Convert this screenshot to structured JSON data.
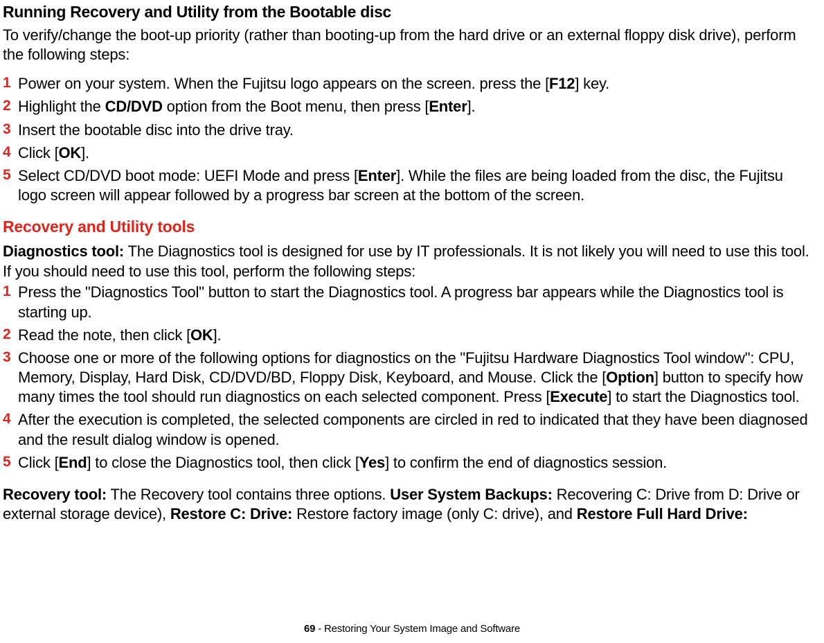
{
  "page": {
    "number": "69",
    "footer_sep": " - ",
    "footer_title": "Restoring Your System Image and Software"
  },
  "section1": {
    "heading": "Running Recovery and Utility from the Bootable disc",
    "lead": "To verify/change the boot-up priority (rather than booting-up from the hard drive or an external floppy disk drive), perform the following steps:",
    "steps": {
      "s1": {
        "n": "1",
        "pre": "Power on your system. When the Fujitsu logo appears on the screen. press the [",
        "b1": "F12",
        "post": "] key."
      },
      "s2": {
        "n": "2",
        "pre": "Highlight the ",
        "b1": "CD/DVD",
        "mid": " option from the Boot menu, then press [",
        "b2": "Enter",
        "post": "]."
      },
      "s3": {
        "n": "3",
        "text": "Insert the bootable disc into the drive tray."
      },
      "s4": {
        "n": "4",
        "pre": "Click [",
        "b1": "OK",
        "post": "]."
      },
      "s5": {
        "n": "5",
        "pre": "Select CD/DVD boot mode: UEFI Mode and press [",
        "b1": "Enter",
        "post": "]. While the files are being loaded from the disc, the Fujitsu logo screen will appear followed by a progress bar screen at the bottom of the screen."
      }
    }
  },
  "section2": {
    "heading": "Recovery and Utility tools",
    "diag": {
      "title": "Diagnostics tool:",
      "lead": " The Diagnostics tool is designed for use by IT professionals. It is not likely you will need to use this tool. If you should need to use this tool, perform the following steps:",
      "steps": {
        "s1": {
          "n": "1",
          "text": "Press the \"Diagnostics Tool\" button to start the Diagnostics tool. A progress bar appears while the Diagnostics tool is starting up."
        },
        "s2": {
          "n": "2",
          "pre": "Read the note, then click [",
          "b1": "OK",
          "post": "]."
        },
        "s3": {
          "n": "3",
          "pre": "Choose one or more of the following options for diagnostics on the \"Fujitsu Hardware Diagnostics Tool window\": CPU, Memory, Display, Hard Disk, CD/DVD/BD, Floppy Disk, Keyboard, and Mouse. Click the [",
          "b1": "Option",
          "mid": "] button to specify how many times the tool should run diagnostics on each selected component. Press [",
          "b2": "Execute",
          "post": "] to start the Diagnostics tool."
        },
        "s4": {
          "n": "4",
          "text": "After the execution is completed, the selected components are circled in red to indicated that they have been diagnosed and the result dialog window is opened."
        },
        "s5": {
          "n": "5",
          "pre": "Click [",
          "b1": "End",
          "mid": "] to close the Diagnostics tool, then click [",
          "b2": "Yes",
          "post": "] to confirm the end of diagnostics session."
        }
      }
    },
    "recov": {
      "title": "Recovery tool:",
      "p1": " The Recovery tool contains three options. ",
      "b1": "User System Backups:",
      "p2": " Recovering C: Drive from D: Drive or external storage device), ",
      "b2": "Restore C: Drive:",
      "p3": " Restore factory image (only C: drive), and ",
      "b3": "Restore Full Hard Drive:"
    }
  }
}
